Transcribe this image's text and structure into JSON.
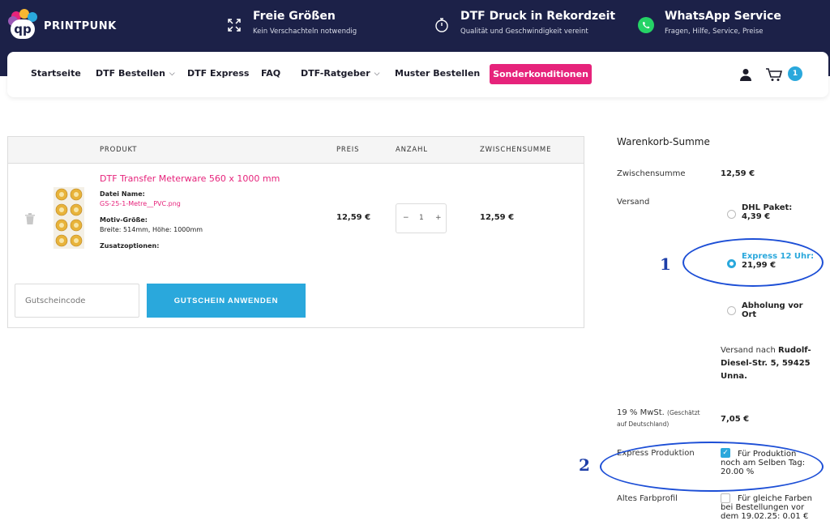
{
  "brand": {
    "logo_text": "PRINTPUNK",
    "logo_letters": "qp"
  },
  "features": [
    {
      "icon": "expand-arrows-icon",
      "title": "Freie Größen",
      "subtitle": "Kein Verschachteln notwendig"
    },
    {
      "icon": "stopwatch-icon",
      "title": "DTF Druck in Rekordzeit",
      "subtitle": "Qualität und Geschwindigkeit vereint"
    },
    {
      "icon": "whatsapp-icon",
      "title": "WhatsApp Service",
      "subtitle": "Fragen, Hilfe, Service, Preise"
    }
  ],
  "nav": {
    "items": [
      "Startseite",
      "DTF Bestellen",
      "DTF Express",
      "FAQ",
      "DTF-Ratgeber",
      "Muster Bestellen"
    ],
    "special": "Sonderkonditionen",
    "cart_count": "1"
  },
  "cart": {
    "headers": {
      "product": "PRODUKT",
      "price": "PREIS",
      "qty": "ANZAHL",
      "subtotal": "ZWISCHENSUMME"
    },
    "item": {
      "name": "DTF Transfer Meterware 560 x 1000 mm",
      "file_label": "Datei Name:",
      "file_value": "GS-25-1-Metre__PVC.png",
      "size_label": "Motiv-Größe:",
      "size_value": "Breite: 514mm, Höhe: 1000mm",
      "extras_label": "Zusatzoptionen:",
      "price": "12,59 €",
      "qty": "1",
      "subtotal": "12,59 €"
    },
    "coupon_placeholder": "Gutscheincode",
    "coupon_button": "GUTSCHEIN ANWENDEN"
  },
  "summary": {
    "title": "Warenkorb-Summe",
    "subtotal_label": "Zwischensumme",
    "subtotal_value": "12,59 €",
    "shipping_label": "Versand",
    "shipping_options": [
      {
        "line1": "DHL Paket:",
        "line2": "4,39 €"
      },
      {
        "line1": "Express 12 Uhr:",
        "line2": "21,99 €"
      },
      {
        "line1": "Abholung vor",
        "line2": "Ort"
      }
    ],
    "ship_to_prefix": "Versand nach",
    "ship_to_address_1": "Rudolf-",
    "ship_to_address_2": "Diesel-Str. 5, 59425",
    "ship_to_address_3": "Unna.",
    "vat_label": "19 % MwSt.",
    "vat_note_1": "(Geschätzt",
    "vat_note_2": "auf Deutschland)",
    "vat_value": "7,05 €",
    "express_label": "Express Produktion",
    "express_text_1": "Für Produktion",
    "express_text_2": "noch am Selben Tag:",
    "express_text_3": "20.00 %",
    "color_label": "Altes Farbprofil",
    "color_text_1": "Für gleiche Farben",
    "color_text_2": "bei Bestellungen vor",
    "color_text_3": "dem 19.02.25: 0.01 €"
  },
  "annotations": {
    "one": "1",
    "two": "2"
  }
}
